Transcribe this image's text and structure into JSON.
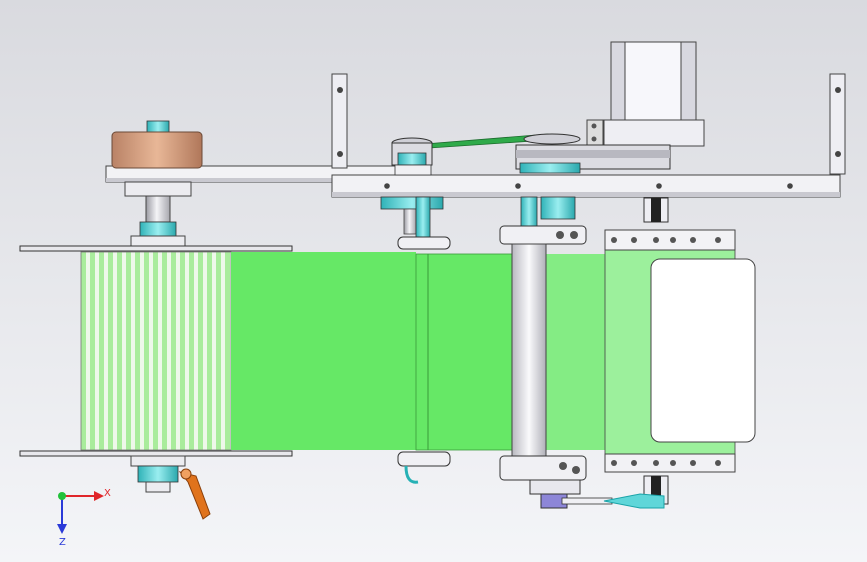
{
  "viewport": {
    "background_top": "#d9dadf",
    "background_bottom": "#f4f5f8"
  },
  "triad": {
    "x_label": "X",
    "z_label": "Z",
    "x_color": "#e0262a",
    "y_color": "#22c13a",
    "z_color": "#2a3ad8"
  },
  "colors": {
    "label_green": "#66e866",
    "label_green_light": "#9cf09c",
    "roll_stripe": "#aef0a0",
    "metal_light": "#f2f2f5",
    "metal_mid": "#c9c9d0",
    "metal_dark": "#8a8a92",
    "cyan": "#5fd6d9",
    "cyan_dark": "#1aa3a8",
    "copper": "#d39a7a",
    "orange_handle": "#e0731c",
    "belt_green": "#2faa4a",
    "motor_white": "#f7f7fb",
    "purple": "#8d86d8"
  }
}
